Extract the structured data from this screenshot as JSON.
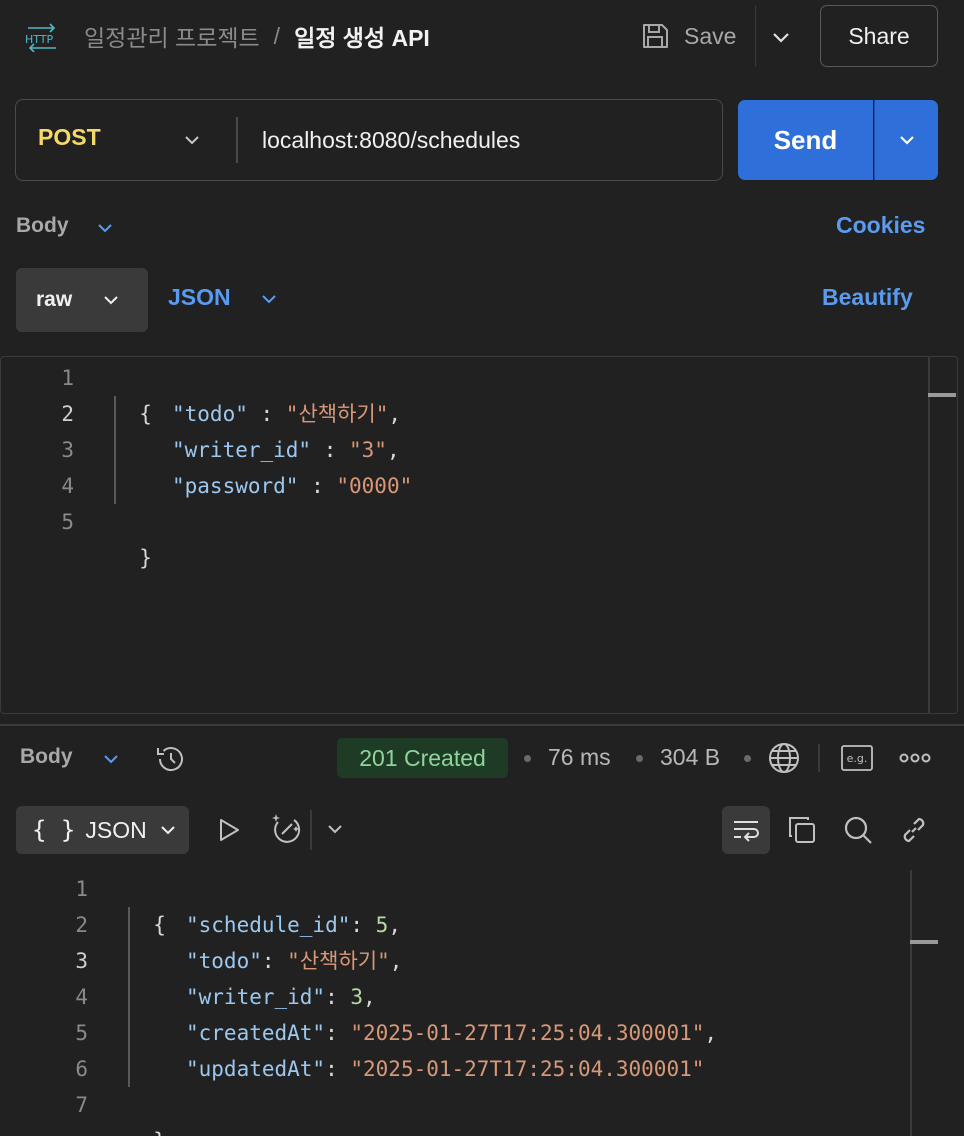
{
  "header": {
    "request_type_icon": "http-icon",
    "breadcrumb": {
      "parent": "일정관리 프로젝트",
      "separator": "/",
      "current": "일정 생성 API"
    },
    "save_label": "Save",
    "share_label": "Share"
  },
  "request": {
    "method": "POST",
    "method_color": "#f4d868",
    "url": "localhost:8080/schedules",
    "send_label": "Send",
    "send_color": "#2f6fda",
    "body_tab_label": "Body",
    "cookies_label": "Cookies",
    "body_mode": "raw",
    "body_language": "JSON",
    "beautify_label": "Beautify",
    "editor": {
      "line_numbers": [
        "1",
        "2",
        "3",
        "4",
        "5"
      ],
      "lines": [
        {
          "brace": "{"
        },
        {
          "key": "\"todo\"",
          "sep": " : ",
          "value": "\"산책하기\"",
          "trail": ","
        },
        {
          "key": "\"writer_id\"",
          "sep": " : ",
          "value": "\"3\"",
          "trail": ","
        },
        {
          "key": "\"password\"",
          "sep": " : ",
          "value": "\"0000\"",
          "trail": ""
        },
        {
          "brace": "}"
        }
      ]
    }
  },
  "response": {
    "body_tab_label": "Body",
    "status": "201 Created",
    "status_color": "#8fd49a",
    "time": "76 ms",
    "size": "304 B",
    "eg_label": "e.g.",
    "format_label": "JSON",
    "format_braces": "{ }",
    "editor": {
      "line_numbers": [
        "1",
        "2",
        "3",
        "4",
        "5",
        "6",
        "7"
      ],
      "lines": [
        {
          "brace": "{"
        },
        {
          "key": "\"schedule_id\"",
          "sep": ": ",
          "value": "5",
          "trail": ","
        },
        {
          "key": "\"todo\"",
          "sep": ": ",
          "value": "\"산책하기\"",
          "trail": ","
        },
        {
          "key": "\"writer_id\"",
          "sep": ": ",
          "value": "3",
          "trail": ","
        },
        {
          "key": "\"createdAt\"",
          "sep": ": ",
          "value": "\"2025-01-27T17:25:04.300001\"",
          "trail": ","
        },
        {
          "key": "\"updatedAt\"",
          "sep": ": ",
          "value": "\"2025-01-27T17:25:04.300001\"",
          "trail": ""
        },
        {
          "brace": "}"
        }
      ]
    }
  }
}
